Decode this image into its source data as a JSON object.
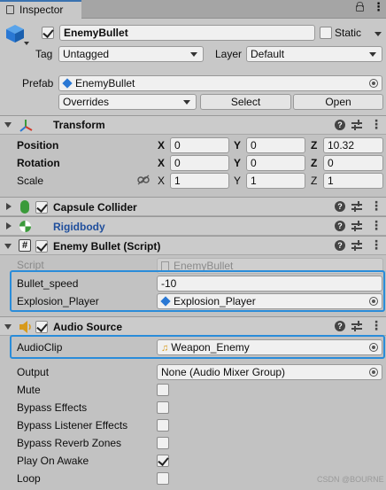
{
  "tab": {
    "title": "Inspector"
  },
  "object": {
    "name": "EnemyBullet",
    "static_label": "Static",
    "active": true,
    "static": false
  },
  "tag": {
    "label": "Tag",
    "value": "Untagged"
  },
  "layer": {
    "label": "Layer",
    "value": "Default"
  },
  "prefab": {
    "label": "Prefab",
    "value": "EnemyBullet",
    "overrides": "Overrides",
    "select": "Select",
    "open": "Open"
  },
  "transform": {
    "title": "Transform",
    "position": {
      "label": "Position",
      "x": "0",
      "y": "0",
      "z": "10.32"
    },
    "rotation": {
      "label": "Rotation",
      "x": "0",
      "y": "0",
      "z": "0"
    },
    "scale": {
      "label": "Scale",
      "x": "1",
      "y": "1",
      "z": "1"
    },
    "axes": {
      "x": "X",
      "y": "Y",
      "z": "Z"
    }
  },
  "capsule_collider": {
    "title": "Capsule Collider",
    "enabled": true
  },
  "rigidbody": {
    "title": "Rigidbody"
  },
  "enemy_bullet": {
    "title": "Enemy Bullet (Script)",
    "enabled": true,
    "script_label": "Script",
    "script_value": "EnemyBullet",
    "speed_label": "Bullet_speed",
    "speed_value": "-10",
    "explosion_label": "Explosion_Player",
    "explosion_value": "Explosion_Player"
  },
  "audio_source": {
    "title": "Audio Source",
    "enabled": true,
    "clip_label": "AudioClip",
    "clip_value": "Weapon_Enemy",
    "output_label": "Output",
    "output_value": "None (Audio Mixer Group)",
    "toggles": [
      {
        "label": "Mute",
        "checked": false
      },
      {
        "label": "Bypass Effects",
        "checked": false
      },
      {
        "label": "Bypass Listener Effects",
        "checked": false
      },
      {
        "label": "Bypass Reverb Zones",
        "checked": false
      },
      {
        "label": "Play On Awake",
        "checked": true
      },
      {
        "label": "Loop",
        "checked": false
      }
    ]
  },
  "watermark": "CSDN @BOURNE",
  "colors": {
    "highlight": "#2a8cd9",
    "header": "#cbcbcb",
    "panel": "#c2c2c2",
    "link": "#1f4e9c"
  }
}
